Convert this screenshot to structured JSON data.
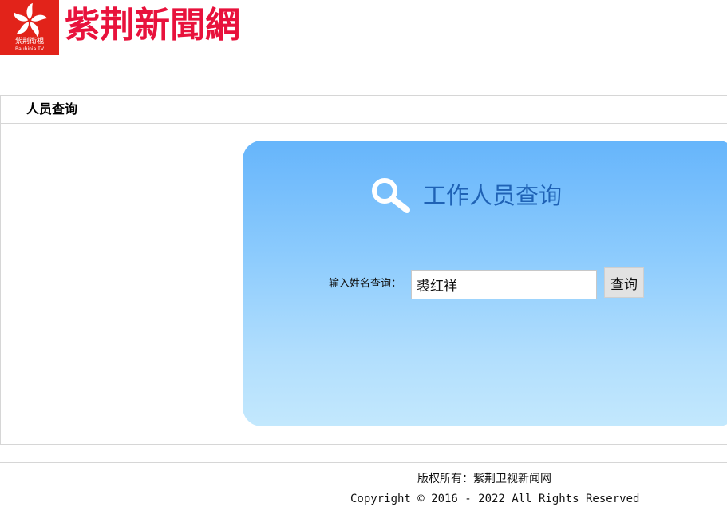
{
  "header": {
    "badge_text": "紫荆衛視",
    "badge_subtext": "Bauhinia TV",
    "site_title": "紫荆新聞網"
  },
  "section": {
    "title": "人员查询"
  },
  "search_panel": {
    "icon": "search-icon",
    "heading": "工作人员查询",
    "label": "输入姓名查询：",
    "input_value": "裘红祥",
    "button_label": "查询"
  },
  "footer": {
    "rights": "版权所有：紫荆卫视新闻网",
    "copyright": "Copyright © 2016 - 2022 All Rights Reserved"
  },
  "colors": {
    "brand_red": "#e2231a",
    "title_pink": "#e8123c",
    "panel_top": "#66b5fb",
    "panel_bottom": "#c3e8fd",
    "heading_blue": "#1f62b5"
  }
}
